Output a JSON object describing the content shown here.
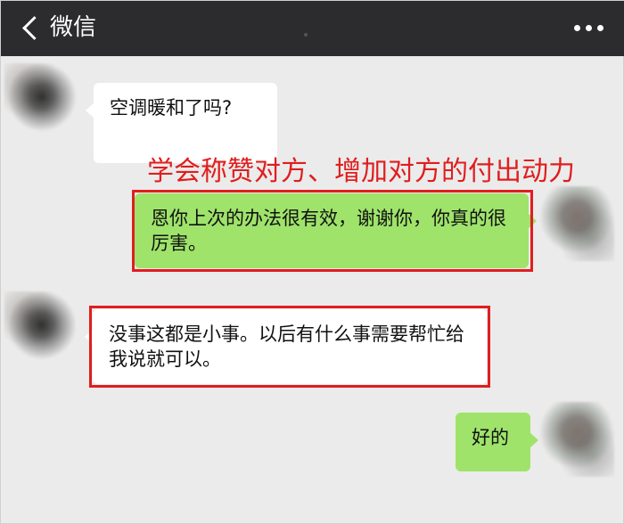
{
  "header": {
    "back_label": "微信",
    "more_icon": "more-dots-icon"
  },
  "annotation": {
    "text": "学会称赞对方、增加对方的付出动力",
    "color": "#e01e1e"
  },
  "messages": [
    {
      "side": "left",
      "text": "空调暖和了吗?"
    },
    {
      "side": "right",
      "text": "恩你上次的办法很有效，谢谢你，你真的很厉害。"
    },
    {
      "side": "left",
      "text": "没事这都是小事。以后有什么事需要帮忙给我说就可以。"
    },
    {
      "side": "right",
      "text": "好的"
    }
  ],
  "colors": {
    "topbar": "#2c2c2e",
    "background": "#ebebeb",
    "green_bubble": "#9fe36b",
    "highlight": "#e01e1e"
  }
}
